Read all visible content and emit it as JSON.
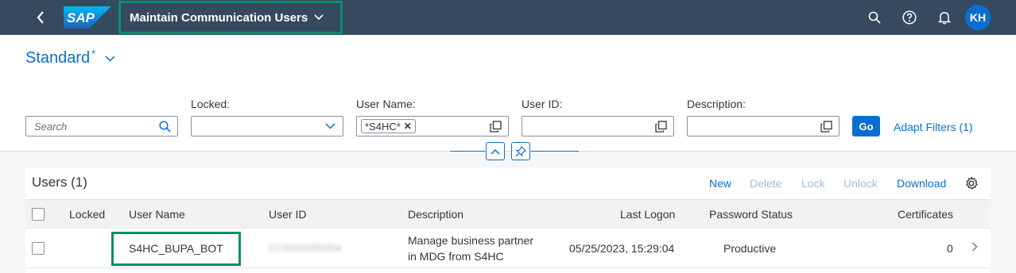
{
  "shell": {
    "app_title": "Maintain Communication Users",
    "logo_text": "SAP",
    "avatar_initials": "KH",
    "icons": [
      "back-icon",
      "search-icon",
      "help-icon",
      "bell-icon"
    ]
  },
  "variant": {
    "name": "Standard",
    "modified_marker": "*"
  },
  "filters": {
    "search_placeholder": "Search",
    "locked_label": "Locked:",
    "locked_value": "",
    "user_name_label": "User Name:",
    "user_name_token": "*S4HC*",
    "user_id_label": "User ID:",
    "description_label": "Description:",
    "go_label": "Go",
    "adapt_label": "Adapt Filters (1)"
  },
  "table": {
    "title": "Users (1)",
    "toolbar": {
      "new": "New",
      "delete": "Delete",
      "lock": "Lock",
      "unlock": "Unlock",
      "download": "Download"
    },
    "columns": {
      "locked": "Locked",
      "user_name": "User Name",
      "user_id": "User ID",
      "description": "Description",
      "last_logon": "Last Logon",
      "password_status": "Password Status",
      "certificates": "Certificates"
    },
    "rows": [
      {
        "user_name": "S4HC_BUPA_BOT",
        "user_id": "CC0000000004",
        "description_line1": "Manage business partner",
        "description_line2": "in MDG from S4HC",
        "last_logon": "05/25/2023, 15:29:04",
        "password_status": "Productive",
        "certificates": "0"
      }
    ]
  },
  "colors": {
    "shell_bg": "#354a5f",
    "accent": "#0a6ed1",
    "highlight_border": "#0b8e6c"
  }
}
